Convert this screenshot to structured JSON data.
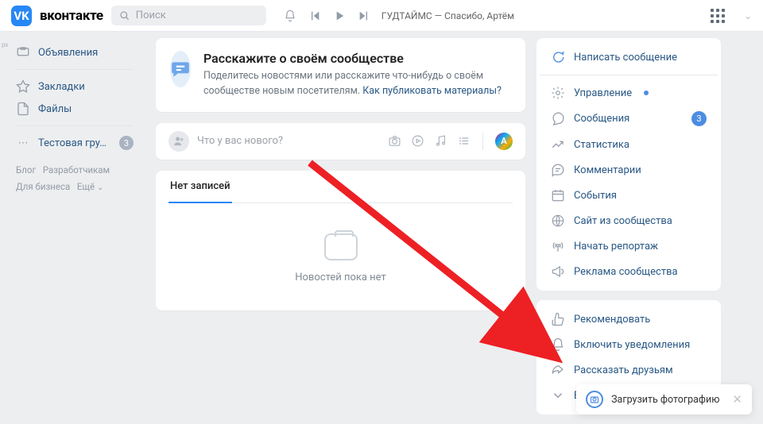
{
  "header": {
    "logo_text": "вконтакте",
    "logo_glyph": "VK",
    "search_placeholder": "Поиск",
    "now_playing": "ГУДТАЙМС — Спасибо, Артём"
  },
  "side_label_tiny": "рх",
  "left_nav": {
    "items": [
      {
        "icon": "megaphone",
        "label": "Объявления"
      },
      {
        "icon": "star",
        "label": "Закладки"
      },
      {
        "icon": "file",
        "label": "Файлы"
      }
    ],
    "group_item": {
      "label": "Тестовая гру...",
      "badge": "3"
    },
    "footer_links": {
      "blog": "Блог",
      "devs": "Разработчикам",
      "biz": "Для бизнеса",
      "more": "Ещё"
    }
  },
  "center": {
    "tell_title": "Расскажите о своём сообществе",
    "tell_sub1": "Поделитесь новостями или расскажите что-нибудь о своём сообществе новым посетителям.",
    "tell_link": "Как публиковать материалы?",
    "compose_placeholder": "Что у вас нового?",
    "avatar_letter": "А",
    "tab_label": "Нет записей",
    "empty_text": "Новостей пока нет"
  },
  "right": {
    "write_msg": "Написать сообщение",
    "items": [
      {
        "icon": "gear",
        "label": "Управление",
        "dot": true
      },
      {
        "icon": "bubble",
        "label": "Сообщения",
        "badge": "3"
      },
      {
        "icon": "trend",
        "label": "Статистика"
      },
      {
        "icon": "comments",
        "label": "Комментарии"
      },
      {
        "icon": "calendar",
        "label": "События"
      },
      {
        "icon": "globe",
        "label": "Сайт из сообщества"
      },
      {
        "icon": "antenna",
        "label": "Начать репортаж"
      },
      {
        "icon": "horn",
        "label": "Реклама сообщества"
      }
    ],
    "actions": [
      {
        "icon": "thumb",
        "label": "Рекомендовать"
      },
      {
        "icon": "bell",
        "label": "Включить уведомления"
      },
      {
        "icon": "share",
        "label": "Рассказать друзьям"
      },
      {
        "icon": "chevron",
        "label": "Ещё"
      }
    ]
  },
  "toast": {
    "label": "Загрузить фотографию"
  }
}
